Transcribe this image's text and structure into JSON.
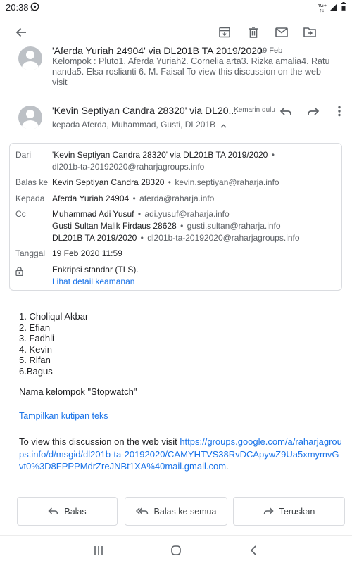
{
  "status_bar": {
    "time": "20:38",
    "network_top": "4G+",
    "network_bottom": "↑↓"
  },
  "toolbar": {
    "icons": [
      "back-arrow-icon",
      "archive-icon",
      "delete-icon",
      "mark-unread-icon",
      "move-to-icon"
    ]
  },
  "previous_message": {
    "sender": "'Aferda Yuriah 24904' via DL201B TA 2019/2020",
    "date": "19 Feb",
    "snippet": "Kelompok : Pluto1. Aferda Yuriah2. Cornelia arta3. Rizka amalia4. Ratu nanda5. Elsa roslianti 6. M. Faisal To view this discussion on the web visit"
  },
  "message": {
    "sender": "'Kevin Septiyan Candra 28320' via DL20...",
    "date": "Kemarin dulu",
    "to_line": "kepada Aferda, Muhammad, Gusti, DL201B"
  },
  "details": {
    "from_label": "Dari",
    "from_name": "'Kevin Septiyan Candra 28320' via DL201B TA 2019/2020",
    "from_email": "dl201b-ta-20192020@raharjagroups.info",
    "reply_label": "Balas ke",
    "reply_name": "Kevin Septiyan Candra 28320",
    "reply_email": "kevin.septiyan@raharja.info",
    "to_label": "Kepada",
    "to_name": "Aferda Yuriah 24904",
    "to_email": "aferda@raharja.info",
    "cc_label": "Cc",
    "cc": [
      {
        "name": "Muhammad Adi Yusuf",
        "email": "adi.yusuf@raharja.info"
      },
      {
        "name": "Gusti Sultan Malik Firdaus 28628",
        "email": "gusti.sultan@raharja.info"
      },
      {
        "name": "DL201B TA 2019/2020",
        "email": "dl201b-ta-20192020@raharjagroups.info"
      }
    ],
    "date_label": "Tanggal",
    "date_value": "19 Feb 2020 11:59",
    "encryption": "Enkripsi standar (TLS).",
    "security_link": "Lihat detail keamanan"
  },
  "body": {
    "list": [
      "1. Choliqul Akbar",
      "2. Efian",
      "3. Fadhli",
      "4. Kevin",
      "5. Rifan",
      "6.Bagus"
    ],
    "group_name_line": "Nama kelompok \"Stopwatch\"",
    "quote_toggle": "Tampilkan kutipan teks",
    "footer_prefix": "To view this discussion on the web visit ",
    "footer_link": "https://groups.google.com/a/raharjagroups.info/d/msgid/dl201b-ta-20192020/CAMYHTVS38RvDCApywZ9Ua5xmymvGvt0%3D8FPPPMdrZreJNBt1XA%40mail.gmail.com",
    "footer_suffix": "."
  },
  "actions": {
    "reply": "Balas",
    "reply_all": "Balas ke semua",
    "forward": "Teruskan"
  },
  "colors": {
    "accent": "#1a73e8",
    "text": "#202124",
    "secondary": "#5f6368",
    "icon": "#5f6368",
    "avatar": "#bdc1c6"
  }
}
